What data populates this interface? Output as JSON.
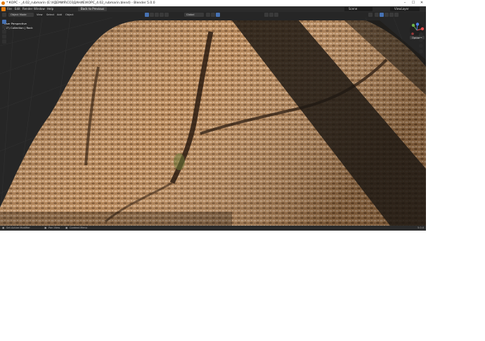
{
  "titlebar": {
    "title": "* КОРС - _4.02_rubmarin (E:\\УДЕМИЯ\\СОЗДАНИЕ\\КОРС_4.02_rubmarin.blend) - Blender 5.0.0"
  },
  "menubar": {
    "items": [
      "File",
      "Edit",
      "Render",
      "Window",
      "Help"
    ],
    "workspace_tab": "Back to Previous",
    "scene": "Scene",
    "view_layer": "ViewLayer"
  },
  "header": {
    "mode": "Object Mode",
    "menus": [
      "View",
      "Select",
      "Add",
      "Object"
    ],
    "transform_orientation": "Global"
  },
  "viewport": {
    "view_name": "User Perspective",
    "collection_info": "(47) Collection | Rock",
    "options_label": "Options",
    "gizmo": {
      "x": "X",
      "y": "Y",
      "z": "Z"
    }
  },
  "statusbar": {
    "item1": "Set Active Modifier",
    "item2": "Pan View",
    "item3": "Context Menu",
    "version": "5.0.0"
  },
  "colors": {
    "accent_blue": "#4772b3",
    "rock_light": "#c79a6b",
    "rock_dark": "#6b4a2f",
    "shadow": "#1c1712"
  }
}
